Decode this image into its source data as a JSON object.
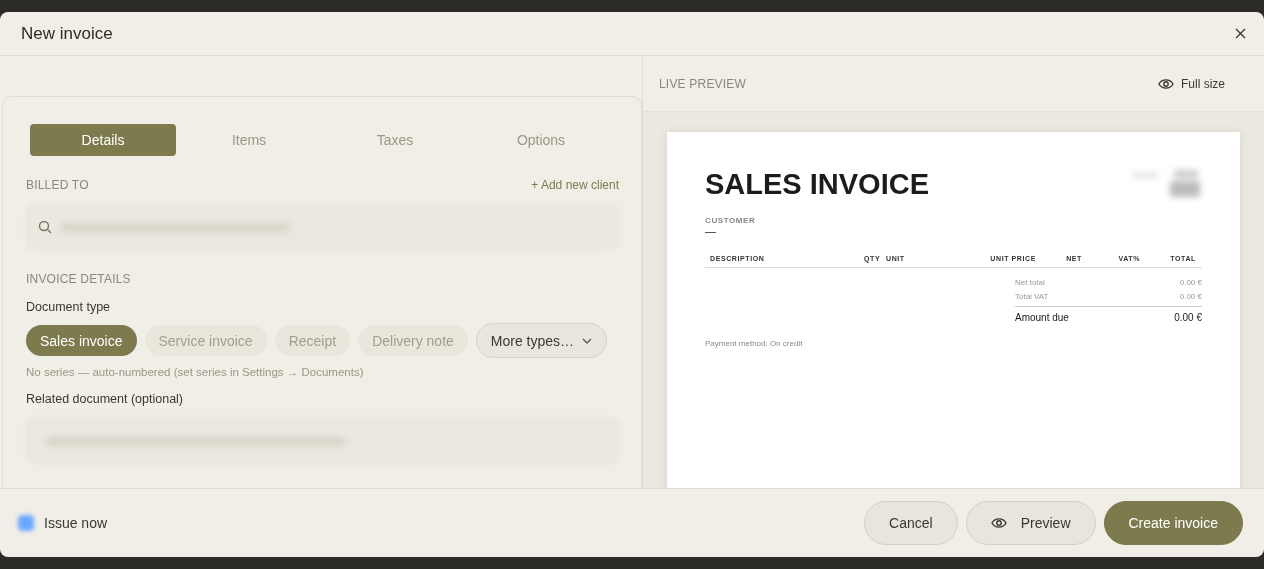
{
  "window": {
    "title": "New invoice"
  },
  "tabs": [
    {
      "label": "Details",
      "selected": true
    },
    {
      "label": "Items",
      "selected": false
    },
    {
      "label": "Taxes",
      "selected": false
    },
    {
      "label": "Options",
      "selected": false
    }
  ],
  "billed_to": {
    "label": "BILLED TO",
    "add_link": "+ Add new client"
  },
  "invoice_details": {
    "label": "INVOICE DETAILS",
    "document_type_label": "Document type",
    "types": [
      {
        "label": "Sales invoice",
        "selected": true
      },
      {
        "label": "Service invoice",
        "selected": false
      },
      {
        "label": "Receipt",
        "selected": false
      },
      {
        "label": "Delivery note",
        "selected": false
      }
    ],
    "more_types": "More types…",
    "series_note": "No series — auto-numbered (set series in Settings → Documents)",
    "related_label": "Related document (optional)"
  },
  "preview": {
    "label": "LIVE PREVIEW",
    "full_size": "Full size",
    "document": {
      "title": "SALES INVOICE",
      "customer_label": "CUSTOMER",
      "customer_value": "—",
      "columns": [
        "DESCRIPTION",
        "QTY",
        "UNIT",
        "UNIT PRICE",
        "NET",
        "VAT%",
        "TOTAL"
      ],
      "totals": [
        {
          "label": "Net total",
          "value": "0.00 €"
        },
        {
          "label": "Total VAT",
          "value": "0.00 €"
        }
      ],
      "amount_due": {
        "label": "Amount due",
        "value": "0.00 €"
      },
      "payment_method": "Payment method: On credit"
    }
  },
  "footer": {
    "issue_now": {
      "label": "Issue now",
      "checked": true
    },
    "buttons": [
      {
        "label": "Cancel",
        "kind": "secondary"
      },
      {
        "label": "Preview",
        "kind": "preview"
      },
      {
        "label": "Create invoice",
        "kind": "primary"
      }
    ]
  }
}
